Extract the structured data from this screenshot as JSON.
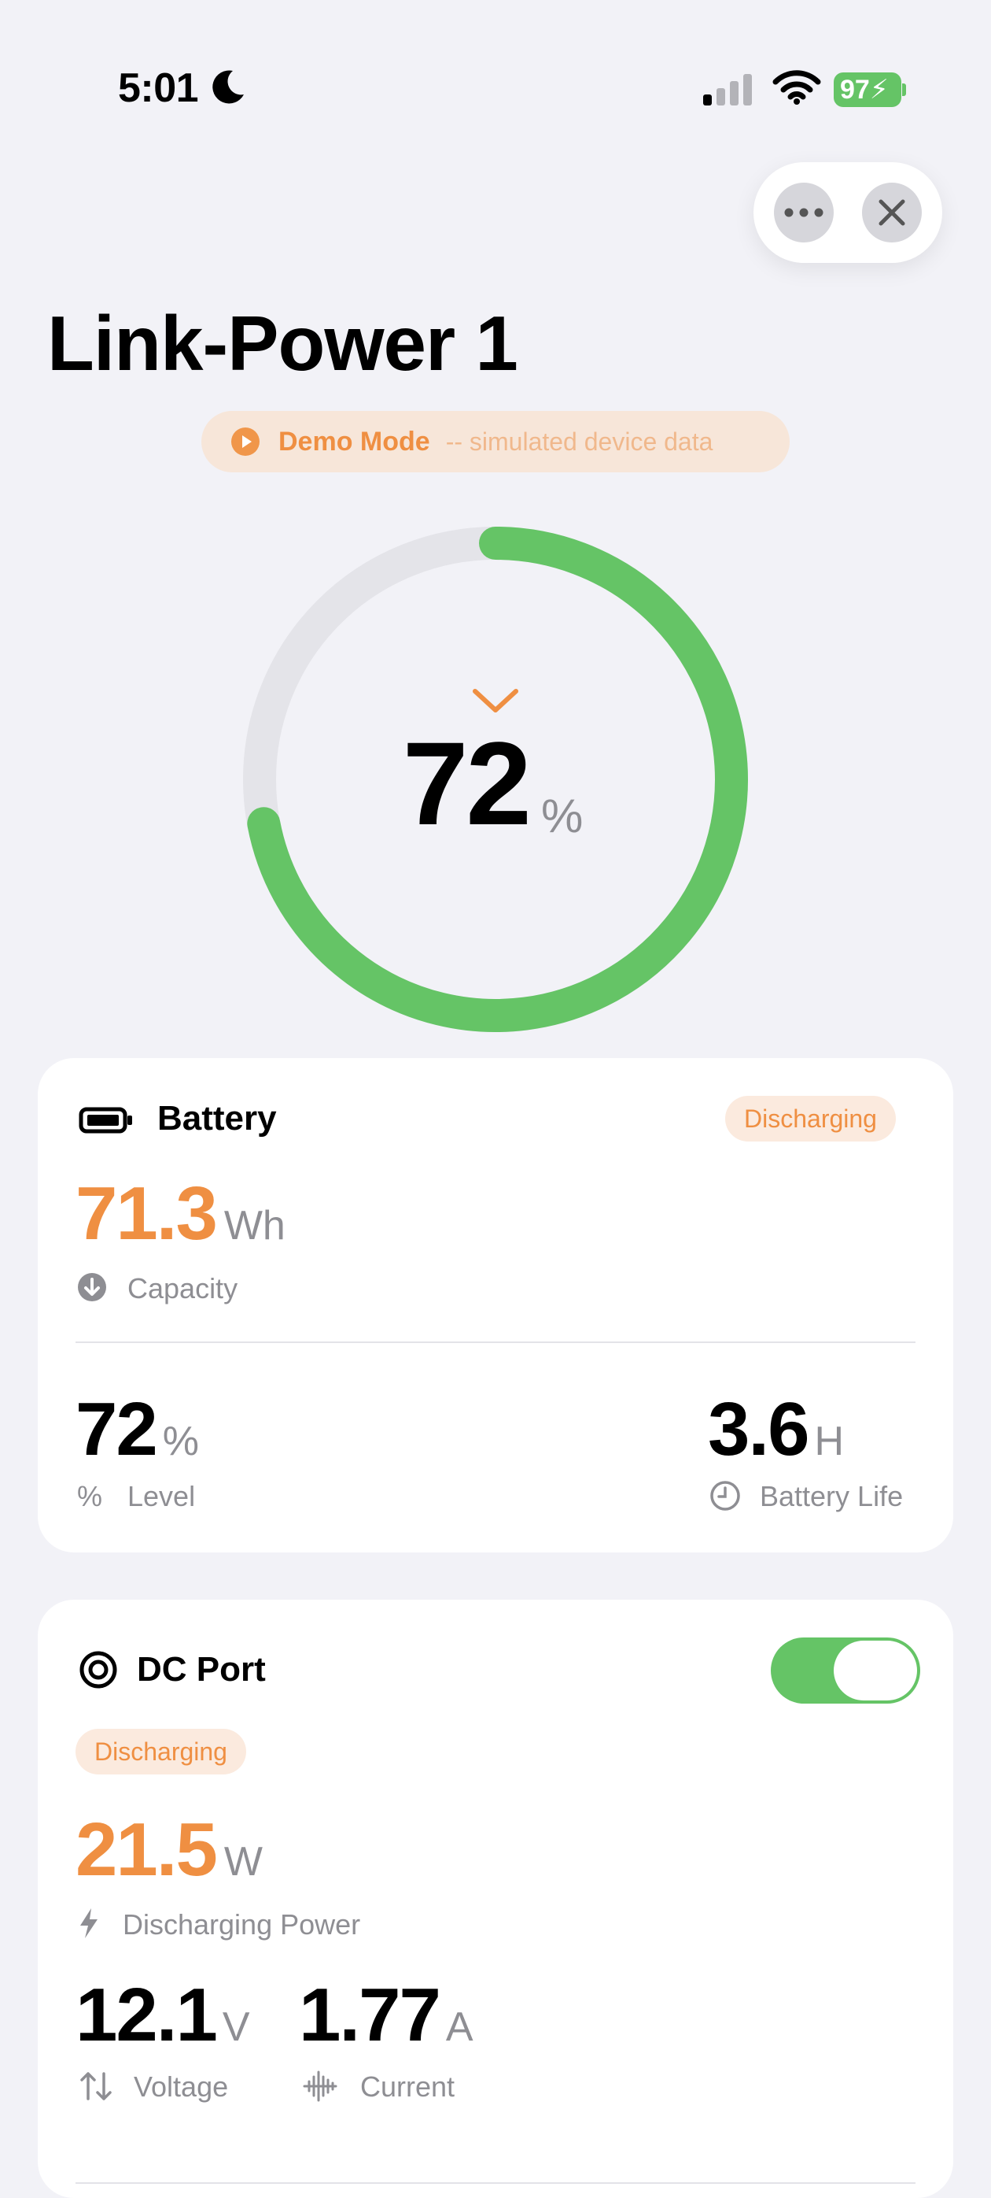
{
  "status_bar": {
    "time": "5:01",
    "battery_level": "97"
  },
  "header": {
    "title": "Link-Power 1"
  },
  "demo": {
    "mode_label": "Demo Mode",
    "description": "-- simulated device data"
  },
  "gauge": {
    "value": "72",
    "unit": "%",
    "level_fraction": 0.72,
    "color": "#65c466",
    "track_color": "#e4e4e9"
  },
  "battery_card": {
    "title": "Battery",
    "status": "Discharging",
    "capacity": {
      "value": "71.3",
      "unit": "Wh",
      "label": "Capacity"
    },
    "level": {
      "value": "72",
      "unit": "%",
      "label": "Level",
      "icon_text": "%"
    },
    "life": {
      "value": "3.6",
      "unit": "H",
      "label": "Battery Life"
    }
  },
  "dc_card": {
    "title": "DC Port",
    "toggle_on": true,
    "status": "Discharging",
    "power": {
      "value": "21.5",
      "unit": "W",
      "label": "Discharging Power"
    },
    "voltage": {
      "value": "12.1",
      "unit": "V",
      "label": "Voltage"
    },
    "current": {
      "value": "1.77",
      "unit": "A",
      "label": "Current"
    }
  },
  "colors": {
    "accent_orange": "#ef8f42",
    "green": "#65c466",
    "background": "#f2f2f7"
  }
}
